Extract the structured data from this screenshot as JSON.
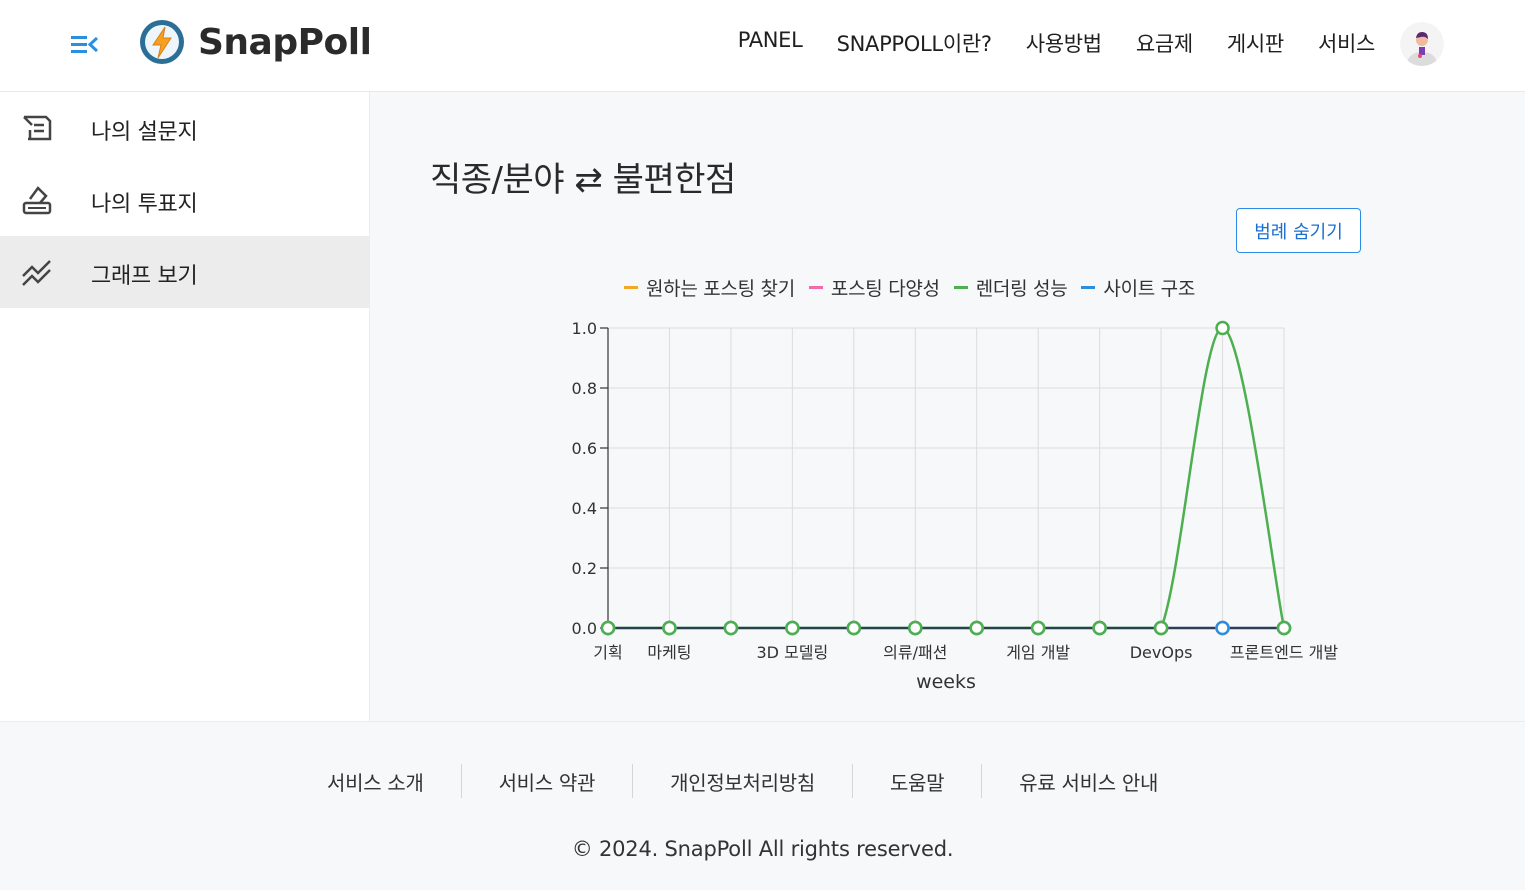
{
  "header": {
    "logo_text": "SnapPoll",
    "nav": [
      "PANEL",
      "SNAPPOLL이란?",
      "사용방법",
      "요금제",
      "게시판",
      "서비스"
    ]
  },
  "sidebar": {
    "items": [
      {
        "label": "나의 설문지",
        "icon": "survey-edit-icon",
        "active": false
      },
      {
        "label": "나의 투표지",
        "icon": "ballot-box-icon",
        "active": false
      },
      {
        "label": "그래프 보기",
        "icon": "trend-chart-icon",
        "active": true
      }
    ]
  },
  "main": {
    "title": "직종/분야 ⇄ 불편한점",
    "legend_toggle_label": "범례 숨기기"
  },
  "chart_data": {
    "type": "line",
    "title": "",
    "xlabel": "weeks",
    "ylabel": "",
    "ylim": [
      0,
      1.0
    ],
    "yticks": [
      "0.0",
      "0.2",
      "0.4",
      "0.6",
      "0.8",
      "1.0"
    ],
    "categories": [
      "기획",
      "마케팅",
      "",
      "3D 모델링",
      "",
      "의류/패션",
      "",
      "게임 개발",
      "",
      "DevOps",
      "",
      "프론트엔드 개발"
    ],
    "grid": true,
    "legend_position": "top",
    "series": [
      {
        "name": "원하는 포스팅 찾기",
        "color": "#f5a623",
        "values": [
          0,
          0,
          0,
          0,
          0,
          0,
          0,
          0,
          0,
          0,
          0,
          0
        ]
      },
      {
        "name": "포스팅 다양성",
        "color": "#f06ba8",
        "values": [
          0,
          0,
          0,
          0,
          0,
          0,
          0,
          0,
          0,
          0,
          0,
          0
        ]
      },
      {
        "name": "렌더링 성능",
        "color": "#4caf50",
        "values": [
          0,
          0,
          0,
          0,
          0,
          0,
          0,
          0,
          0,
          0,
          1,
          0
        ]
      },
      {
        "name": "사이트 구조",
        "color": "#2b8fe0",
        "values": [
          0,
          0,
          0,
          0,
          0,
          0,
          0,
          0,
          0,
          0,
          0,
          0
        ]
      }
    ]
  },
  "footer": {
    "links": [
      "서비스 소개",
      "서비스 약관",
      "개인정보처리방침",
      "도움말",
      "유료 서비스 안내"
    ],
    "copyright": "© 2024. SnapPoll All rights reserved."
  }
}
